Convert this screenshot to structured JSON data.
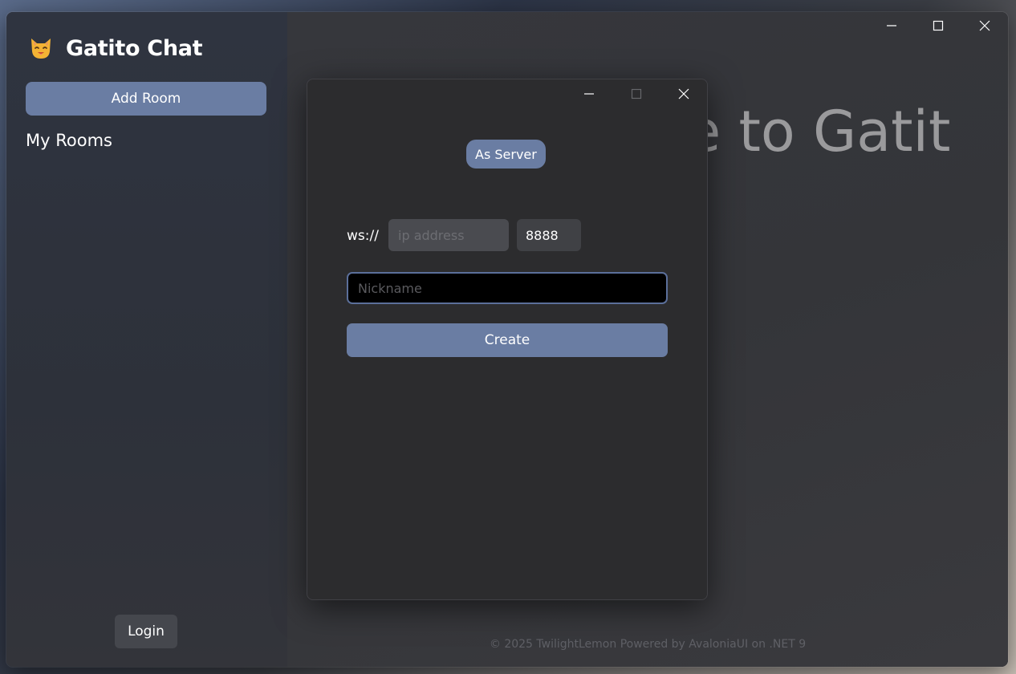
{
  "app": {
    "title": "Gatito Chat",
    "add_room_label": "Add Room",
    "rooms_heading": "My Rooms",
    "login_label": "Login",
    "welcome_text": "Welcome to Gatito",
    "footer": "© 2025 TwilightLemon Powered by AvaloniaUI on .NET 9",
    "icon": "cat-face-icon"
  },
  "window_controls": {
    "minimize": "minimize-icon",
    "maximize": "maximize-icon",
    "close": "close-icon"
  },
  "dialog": {
    "mode_label": "As Server",
    "protocol_label": "ws://",
    "ip": {
      "value": "",
      "placeholder": "ip address"
    },
    "port": {
      "value": "8888"
    },
    "nickname": {
      "value": "",
      "placeholder": "Nickname"
    },
    "create_label": "Create"
  },
  "colors": {
    "accent": "#6a7da3",
    "sidebar_bg": "#2f3440",
    "dialog_bg": "#2c2c2e",
    "focus_border": "#5b6f9a"
  }
}
